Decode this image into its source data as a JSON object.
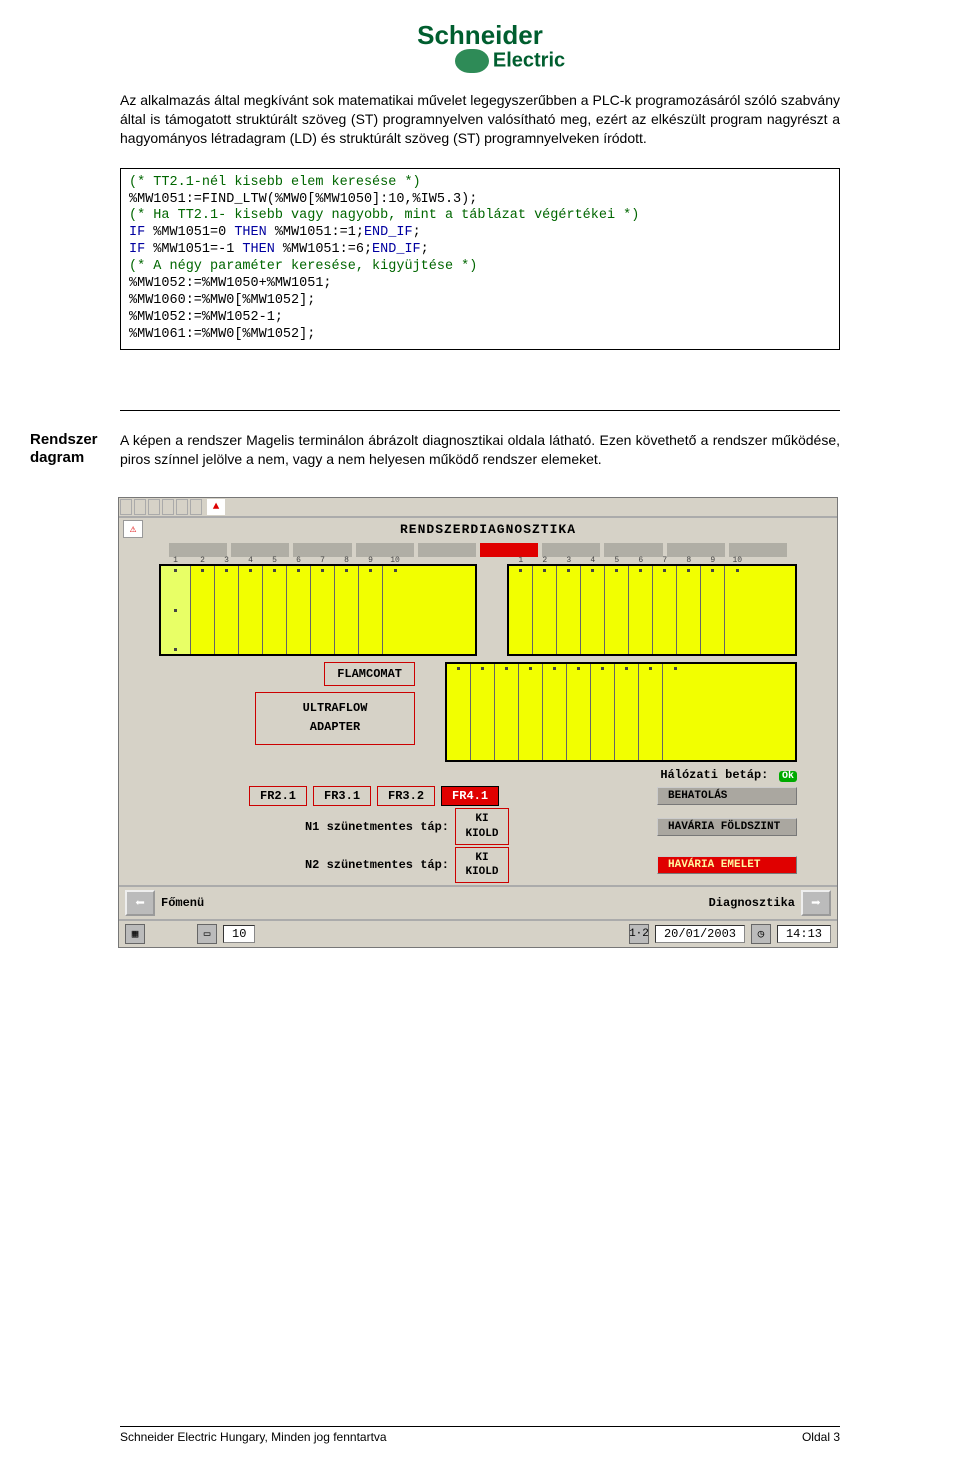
{
  "logo": {
    "main": "Schneider",
    "sub": "Electric"
  },
  "intro_para": "Az alkalmazás által megkívánt sok matematikai művelet legegyszerűbben a PLC-k programozásáról szóló szabvány által is támogatott struktúrált szöveg (ST) programnyelven valósítható meg, ezért az elkészült program nagyrészt a hagyományos létradagram (LD) és struktúrált szöveg (ST) programnyelveken íródott.",
  "code": {
    "l1": "(* TT2.1-nél kisebb elem keresése *)",
    "l2": "%MW1051:=FIND_LTW(%MW0[%MW1050]:10,%IW5.3);",
    "l3": "(* Ha TT2.1- kisebb vagy nagyobb, mint a táblázat végértékei *)",
    "l4a": "IF",
    "l4b": " %MW1051=0 ",
    "l4c": "THEN",
    "l4d": " %MW1051:=1;",
    "l4e": "END_IF",
    "l4f": ";",
    "l5a": "IF",
    "l5b": " %MW1051=-1 ",
    "l5c": "THEN",
    "l5d": " %MW1051:=6;",
    "l5e": "END_IF",
    "l5f": ";",
    "l6": "(* A négy paraméter keresése, kigyüjtése *)",
    "l7": "%MW1052:=%MW1050+%MW1051;",
    "l8": "%MW1060:=%MW0[%MW1052];",
    "l9": "%MW1052:=%MW1052-1;",
    "l10": "%MW1061:=%MW0[%MW1052];"
  },
  "section": {
    "heading": "Rendszer dagram",
    "desc": "A képen a rendszer Magelis terminálon ábrázolt diagnosztikai oldala látható. Ezen követhető a rendszer működése, piros színnel jelölve a nem, vagy a nem helyesen működő rendszer elemeket."
  },
  "diag": {
    "title": "RENDSZERDIAGNOSZTIKA",
    "flamcomat": "FLAMCOMAT",
    "ultraflow": "ULTRAFLOW",
    "adapter": "ADAPTER",
    "net_label": "Hálózati betáp:",
    "ok": "Ok",
    "fr": [
      "FR2.1",
      "FR3.1",
      "FR3.2",
      "FR4.1"
    ],
    "status_btns": [
      "BEHATOLÁS",
      "HAVÁRIA FÖLDSZINT",
      "HAVÁRIA EMELET"
    ],
    "n1": "N1 szünetmentes táp:",
    "n2": "N2 szünetmentes táp:",
    "ki": "KI",
    "kiold": "KIOLD",
    "nav_left": "Főmenü",
    "nav_right": "Diagnosztika",
    "bottom_num": "10",
    "bottom_date": "20/01/2003",
    "bottom_time": "14:13"
  },
  "footer": {
    "left": "Schneider Electric Hungary, Minden jog fenntartva",
    "right": "Oldal 3"
  }
}
